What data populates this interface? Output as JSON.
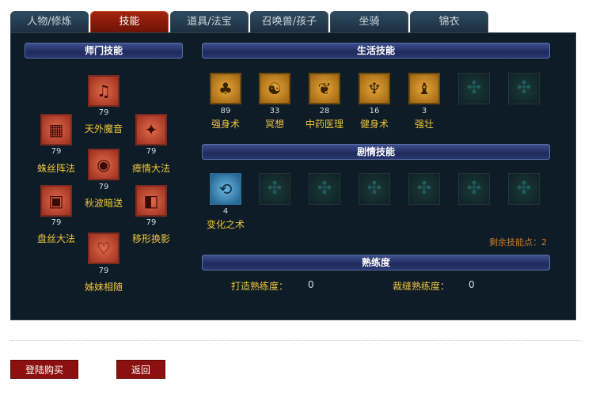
{
  "tabs": [
    "人物/修炼",
    "技能",
    "道具/法宝",
    "召唤兽/孩子",
    "坐骑",
    "锦衣"
  ],
  "active_tab": "技能",
  "headers": {
    "school": "师门技能",
    "life": "生活技能",
    "story": "剧情技能",
    "proficiency": "熟练度"
  },
  "school_skills": [
    {
      "name": "天外魔音",
      "level": "79",
      "icon": "bell-icon"
    },
    {
      "name": "蛛丝阵法",
      "level": "79",
      "icon": "web-icon"
    },
    {
      "name": "瘴情大法",
      "level": "79",
      "icon": "dance-icon"
    },
    {
      "name": "秋波暗送",
      "level": "79",
      "icon": "eye-icon"
    },
    {
      "name": "盘丝大法",
      "level": "79",
      "icon": "coil-icon"
    },
    {
      "name": "移形换影",
      "level": "79",
      "icon": "shadow-icon"
    },
    {
      "name": "姊妹相随",
      "level": "79",
      "icon": "heart-icon"
    }
  ],
  "life_skills": [
    {
      "name": "强身术",
      "level": "89",
      "icon": "strength-icon"
    },
    {
      "name": "冥想",
      "level": "33",
      "icon": "meditate-icon"
    },
    {
      "name": "中药医理",
      "level": "28",
      "icon": "herb-icon"
    },
    {
      "name": "健身术",
      "level": "16",
      "icon": "fitness-icon"
    },
    {
      "name": "强壮",
      "level": "3",
      "icon": "muscle-icon"
    }
  ],
  "life_empty_count": 2,
  "story_skills": [
    {
      "name": "变化之术",
      "level": "4",
      "icon": "transform-icon"
    }
  ],
  "story_empty_count": 6,
  "remaining_points": "剩余技能点：2",
  "proficiency": {
    "forge_label": "打造熟练度：",
    "forge_value": "0",
    "tailor_label": "裁缝熟练度：",
    "tailor_value": "0"
  },
  "buttons": {
    "login_buy": "登陆购买",
    "back": "返回"
  }
}
